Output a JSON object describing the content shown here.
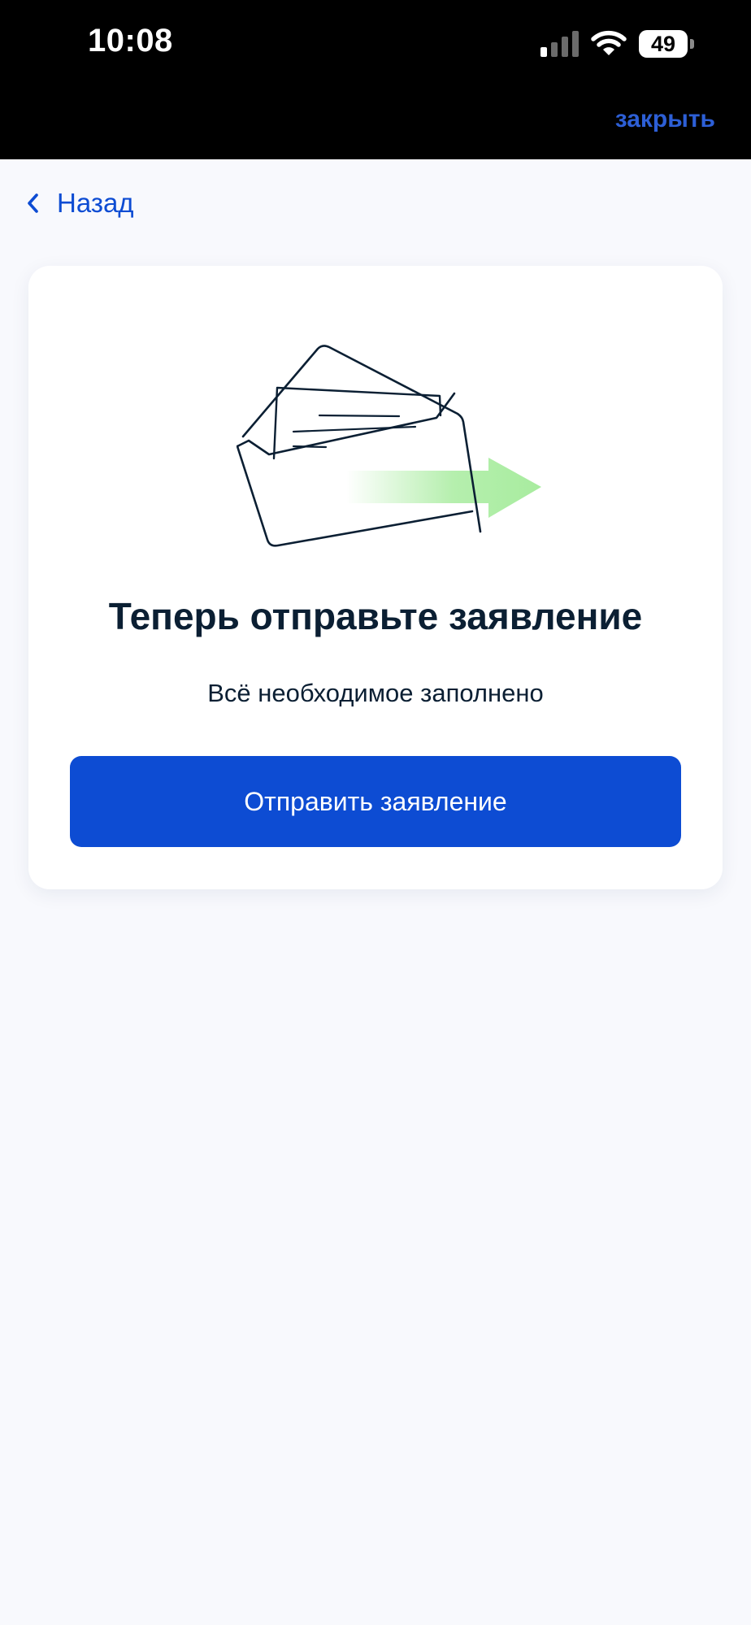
{
  "status_bar": {
    "time": "10:08",
    "battery": "49"
  },
  "header": {
    "close_label": "закрыть"
  },
  "nav": {
    "back_label": "Назад"
  },
  "card": {
    "title": "Теперь отправьте заявление",
    "subtitle": "Всё необходимое заполнено",
    "button_label": "Отправить заявление"
  },
  "colors": {
    "accent": "#0d4cd3",
    "close_link": "#2d5fd6",
    "background": "#f8f9fd",
    "text": "#0b1f33",
    "arrow_green": "#a8ec9f"
  },
  "icons": [
    "signal-icon",
    "wifi-icon",
    "battery-icon",
    "chevron-left-icon",
    "envelope-illustration"
  ]
}
